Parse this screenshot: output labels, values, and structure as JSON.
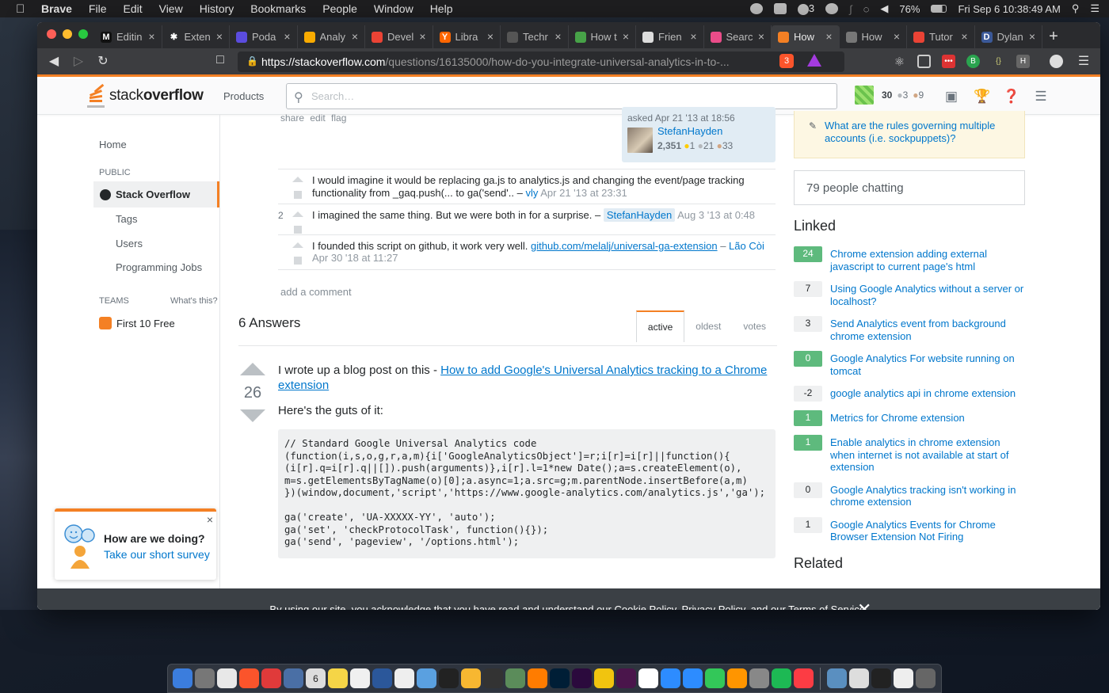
{
  "menubar": {
    "app": "Brave",
    "items": [
      "File",
      "Edit",
      "View",
      "History",
      "Bookmarks",
      "People",
      "Window",
      "Help"
    ],
    "p3": "3",
    "battery": "76%",
    "datetime": "Fri Sep 6  10:38:49 AM"
  },
  "browser": {
    "tabs": [
      {
        "label": "Editin",
        "fav_color": "#111111",
        "fav_text": "M"
      },
      {
        "label": "Exten",
        "fav_color": "#2a2b2e",
        "fav_text": "✱"
      },
      {
        "label": "Poda",
        "fav_color": "#5b4cde",
        "fav_text": ""
      },
      {
        "label": "Analy",
        "fav_color": "#f9ab00",
        "fav_text": ""
      },
      {
        "label": "Devel",
        "fav_color": "#ea4335",
        "fav_text": ""
      },
      {
        "label": "Libra",
        "fav_color": "#ff6600",
        "fav_text": "Y"
      },
      {
        "label": "Techr",
        "fav_color": "#555555",
        "fav_text": ""
      },
      {
        "label": "How t",
        "fav_color": "#47a248",
        "fav_text": ""
      },
      {
        "label": "Frien",
        "fav_color": "#dddddd",
        "fav_text": ""
      },
      {
        "label": "Searc",
        "fav_color": "#ea4c89",
        "fav_text": ""
      },
      {
        "label": "How",
        "fav_color": "#f48024",
        "fav_text": ""
      },
      {
        "label": "How",
        "fav_color": "#777777",
        "fav_text": ""
      },
      {
        "label": "Tutor",
        "fav_color": "#ea4335",
        "fav_text": ""
      },
      {
        "label": "Dylan",
        "fav_color": "#3b5998",
        "fav_text": "D"
      }
    ],
    "new_tab": "+",
    "url_host": "https://stackoverflow.com",
    "url_path": "/questions/16135000/how-do-you-integrate-universal-analytics-in-to-...",
    "shield_count": "3"
  },
  "so": {
    "logo_light": "stack",
    "logo_bold": "overflow",
    "products": "Products",
    "search_placeholder": "Search…",
    "user": {
      "rep": "30",
      "silver": "3",
      "bronze": "9"
    }
  },
  "leftnav": {
    "home": "Home",
    "public": "PUBLIC",
    "active": "Stack Overflow",
    "tags": "Tags",
    "users": "Users",
    "jobs": "Programming Jobs",
    "teams": "TEAMS",
    "whats_this": "What's this?",
    "first10": "First 10 Free"
  },
  "survey": {
    "question": "How are we doing?",
    "link": "Take our short survey",
    "close": "×"
  },
  "question_footer": {
    "links": "share edit flag",
    "asked": "asked Apr 21 '13 at 18:56",
    "user": "StefanHayden",
    "rep": "2,351",
    "gold": "1",
    "silver": "21",
    "bronze": "33"
  },
  "comments": [
    {
      "score": "",
      "text": "I would imagine it would be replacing ga.js to analytics.js and changing the event/page tracking functionality from _gaq.push(... to ga('send'.. – ",
      "user": "vly",
      "date": "Apr 21 '13 at 23:31",
      "link": ""
    },
    {
      "score": "2",
      "text": "I imagined the same thing. But we were both in for a surprise. – ",
      "user": "StefanHayden",
      "date": "Aug 3 '13 at 0:48",
      "link": ""
    },
    {
      "score": "",
      "text": "I founded this script on github, it work very well. ",
      "link": "github.com/melalj/universal-ga-extension",
      "user": "Lão Còi",
      "date": "Apr 30 '18 at 11:27"
    }
  ],
  "add_comment": "add a comment",
  "answers": {
    "count": "6 Answers",
    "sort": [
      "active",
      "oldest",
      "votes"
    ]
  },
  "answer": {
    "votes": "26",
    "intro": "I wrote up a blog post on this - ",
    "blog_link": "How to add Google's Universal Analytics tracking to a Chrome extension",
    "guts": "Here's the guts of it:",
    "code": "// Standard Google Universal Analytics code\n(function(i,s,o,g,r,a,m){i['GoogleAnalyticsObject']=r;i[r]=i[r]||function(){\n(i[r].q=i[r].q||[]).push(arguments)},i[r].l=1*new Date();a=s.createElement(o),\nm=s.getElementsByTagName(o)[0];a.async=1;a.src=g;m.parentNode.insertBefore(a,m)\n})(window,document,'script','https://www.google-analytics.com/analytics.js','ga');\n\nga('create', 'UA-XXXXX-YY', 'auto');\nga('set', 'checkProtocolTask', function(){});\nga('send', 'pageview', '/options.html');"
  },
  "sidebar": {
    "meta_link": "What are the rules governing multiple accounts (i.e. sockpuppets)?",
    "chat": "79 people chatting",
    "linked_title": "Linked",
    "linked": [
      {
        "score": "24",
        "title": "Chrome extension adding external javascript to current page's html",
        "accepted": true
      },
      {
        "score": "7",
        "title": "Using Google Analytics without a server or localhost?",
        "accepted": false
      },
      {
        "score": "3",
        "title": "Send Analytics event from background chrome extension",
        "accepted": false
      },
      {
        "score": "0",
        "title": "Google Analytics For website running on tomcat",
        "accepted": true
      },
      {
        "score": "-2",
        "title": "google analytics api in chrome extension",
        "accepted": false
      },
      {
        "score": "1",
        "title": "Metrics for Chrome extension",
        "accepted": true
      },
      {
        "score": "1",
        "title": "Enable analytics in chrome extension when internet is not available at start of extension",
        "accepted": true
      },
      {
        "score": "0",
        "title": "Google Analytics tracking isn't working in chrome extension",
        "accepted": false
      },
      {
        "score": "1",
        "title": "Google Analytics Events for Chrome Browser Extension Not Firing",
        "accepted": false
      }
    ],
    "related_title": "Related"
  },
  "cookie": {
    "pre": "By using our site, you acknowledge that you have read and understand our ",
    "cookie_policy": "Cookie Policy",
    "comma": ", ",
    "privacy_policy": "Privacy Policy",
    "and": ", and our ",
    "terms": "Terms of Service",
    "dot": ".",
    "close": "✕"
  },
  "dock": {
    "calendar_day": "6",
    "icons": [
      "#3b7ddd",
      "#777",
      "#e8e8e8",
      "#fb542b",
      "#e03a3a",
      "#4a6fa5",
      "#dddddd",
      "#f5d547",
      "#f0f0f0",
      "#2b579a",
      "#eeeeee",
      "#5aa0e0",
      "#222222",
      "#f7b731",
      "#333333",
      "#5b8c5a",
      "#ff7c00",
      "#001e36",
      "#2b0a3d",
      "#f1c40f",
      "#4a154b",
      "#ffffff",
      "#2d8cff",
      "#2d8cff",
      "#33c759",
      "#ff9500",
      "#888888",
      "#1db954",
      "#fc3c44"
    ],
    "right_icons": [
      "#5a8fc0",
      "#dddddd",
      "#222222",
      "#eeeeee",
      "#666666"
    ]
  },
  "colors": {
    "so_orange": "#f48024",
    "link_blue": "#0077cc",
    "accepted_green": "#5eba7d"
  }
}
